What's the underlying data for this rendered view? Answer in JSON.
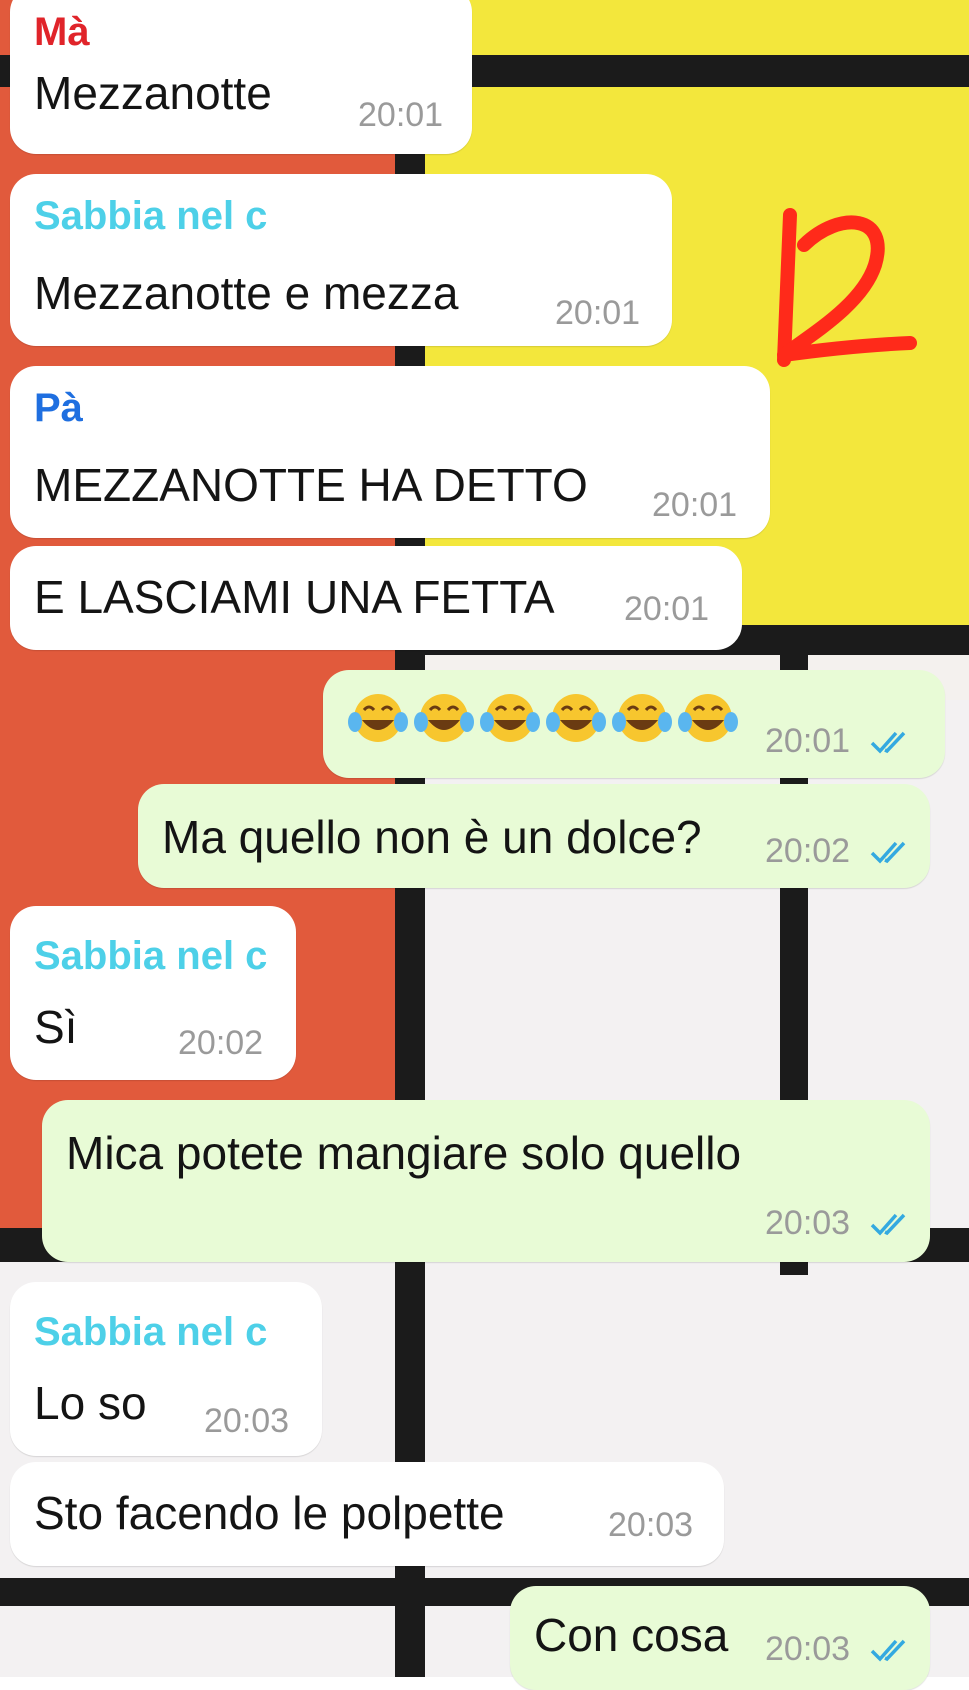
{
  "colors": {
    "incoming_bubble": "#ffffff",
    "outgoing_bubble": "#e8fbd6",
    "sender_ma": "#e0242a",
    "sender_sabbia": "#4dd0e8",
    "sender_pa": "#1f6fe0",
    "read_tick": "#34a9e0",
    "annotation": "#ff2a1a"
  },
  "annotation": {
    "label": "12"
  },
  "messages": [
    {
      "direction": "in",
      "sender": "Mà",
      "text": "Mezzanotte",
      "time": "20:01"
    },
    {
      "direction": "in",
      "sender": "Sabbia nel c",
      "text": "Mezzanotte e mezza",
      "time": "20:01"
    },
    {
      "direction": "in",
      "sender": "Pà",
      "text": "MEZZANOTTE HA DETTO",
      "time": "20:01"
    },
    {
      "direction": "in",
      "text": "E LASCIAMI UNA FETTA",
      "time": "20:01"
    },
    {
      "direction": "out",
      "text": "😂😂😂😂😂😂",
      "emoji": "face-with-tears-of-joy",
      "emoji_count": 6,
      "time": "20:01",
      "status": "read"
    },
    {
      "direction": "out",
      "text": "Ma quello non è un dolce?",
      "time": "20:02",
      "status": "read"
    },
    {
      "direction": "in",
      "sender": "Sabbia nel c",
      "text": "Sì",
      "time": "20:02"
    },
    {
      "direction": "out",
      "text": "Mica potete mangiare solo quello",
      "time": "20:03",
      "status": "read"
    },
    {
      "direction": "in",
      "sender": "Sabbia nel c",
      "text": "Lo so",
      "time": "20:03"
    },
    {
      "direction": "in",
      "text": "Sto facendo le polpette",
      "time": "20:03"
    },
    {
      "direction": "out",
      "text": "Con cosa",
      "time": "20:03",
      "status": "read"
    }
  ]
}
